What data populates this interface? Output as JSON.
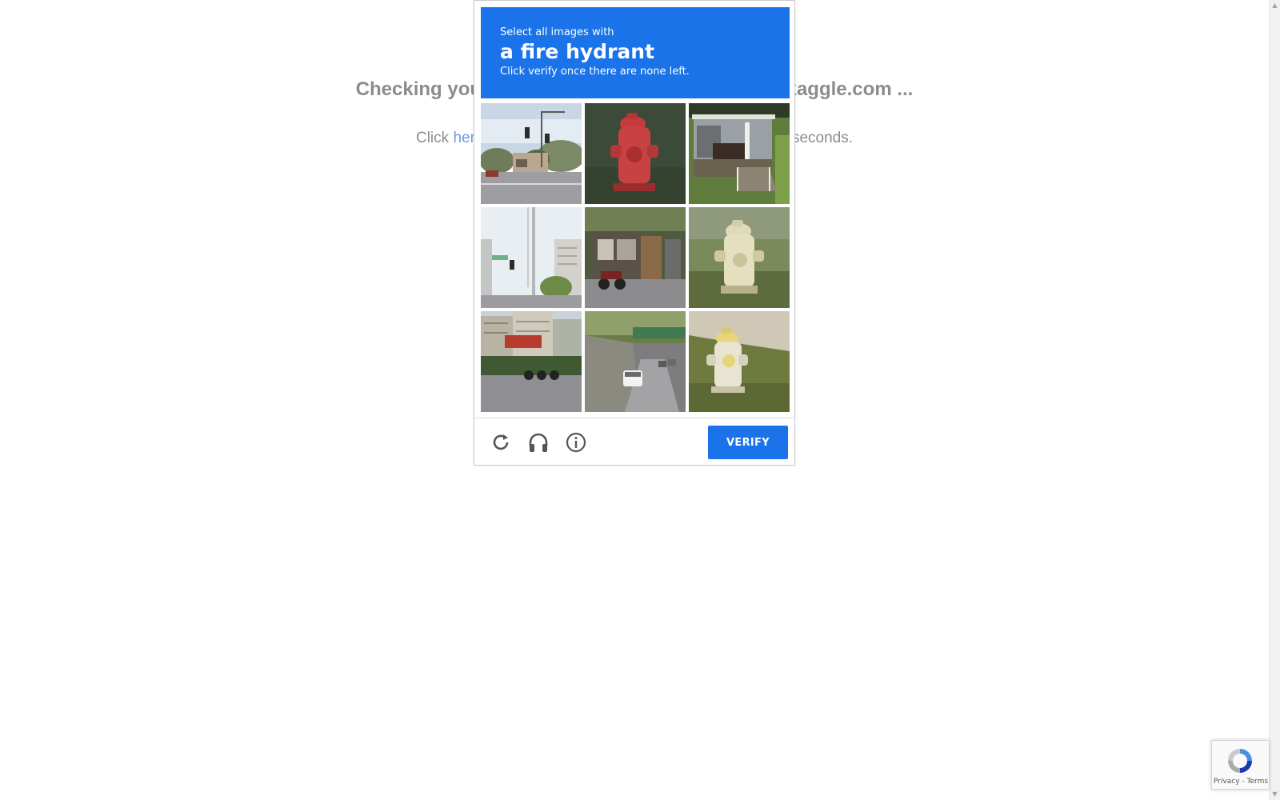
{
  "background": {
    "heading": "Checking your browser before accessing www.kaggle.com ...",
    "sub_prefix": "Click ",
    "sub_link": "here",
    "sub_suffix": " if you are not automatically redirected after 5 seconds."
  },
  "captcha": {
    "line1": "Select all images with",
    "target": "a fire hydrant",
    "line3": "Click verify once there are none left.",
    "tiles": [
      {
        "subject": "street intersection with traffic lights"
      },
      {
        "subject": "red fire hydrant"
      },
      {
        "subject": "house porch"
      },
      {
        "subject": "street with tall buildings and traffic light"
      },
      {
        "subject": "motorcycles parked by a kiosk"
      },
      {
        "subject": "yellow fire hydrant"
      },
      {
        "subject": "buildings and parked motorcycles"
      },
      {
        "subject": "road under a bridge with cars"
      },
      {
        "subject": "yellow fire hydrant on grass"
      }
    ],
    "footer": {
      "reload_icon": "reload-icon",
      "audio_icon": "headphones-icon",
      "info_icon": "info-icon",
      "verify_label": "VERIFY"
    },
    "colors": {
      "accent": "#1a73e8"
    }
  },
  "badge": {
    "text": "Privacy - Terms"
  }
}
